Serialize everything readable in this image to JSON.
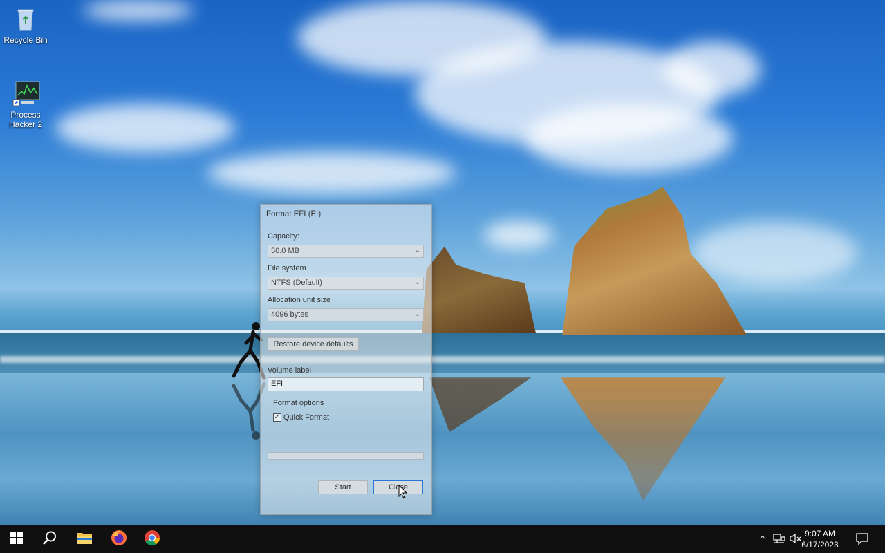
{
  "desktop": {
    "icons": [
      {
        "label": "Recycle Bin",
        "icon": "recycle-bin-icon"
      },
      {
        "label": "Process Hacker 2",
        "icon": "process-hacker-icon"
      }
    ]
  },
  "dialog": {
    "title": "Format EFI (E:)",
    "capacity_label": "Capacity:",
    "capacity_value": "50.0 MB",
    "filesystem_label": "File system",
    "filesystem_value": "NTFS (Default)",
    "alloc_label": "Allocation unit size",
    "alloc_value": "4096 bytes",
    "restore_label": "Restore device defaults",
    "volume_label_label": "Volume label",
    "volume_label_value": "EFI",
    "format_options_label": "Format options",
    "quick_format_label": "Quick Format",
    "quick_format_checked": true,
    "progress_fraction": 0,
    "start_label": "Start",
    "close_label": "Close"
  },
  "taskbar": {
    "apps": [
      {
        "name": "start-button",
        "icon": "windows-logo-icon"
      },
      {
        "name": "search-button",
        "icon": "search-icon"
      },
      {
        "name": "file-explorer",
        "icon": "folder-icon"
      },
      {
        "name": "firefox",
        "icon": "firefox-icon"
      },
      {
        "name": "chrome",
        "icon": "chrome-icon"
      }
    ],
    "tray": {
      "chevron_icon": "chevron-up-icon",
      "network_icon": "network-icon",
      "volume_icon": "volume-muted-icon",
      "notification_icon": "notification-icon"
    },
    "time": "9:07 AM",
    "date": "6/17/2023"
  },
  "colors": {
    "taskbar": "#101010",
    "progress_fill": "#06b025"
  }
}
